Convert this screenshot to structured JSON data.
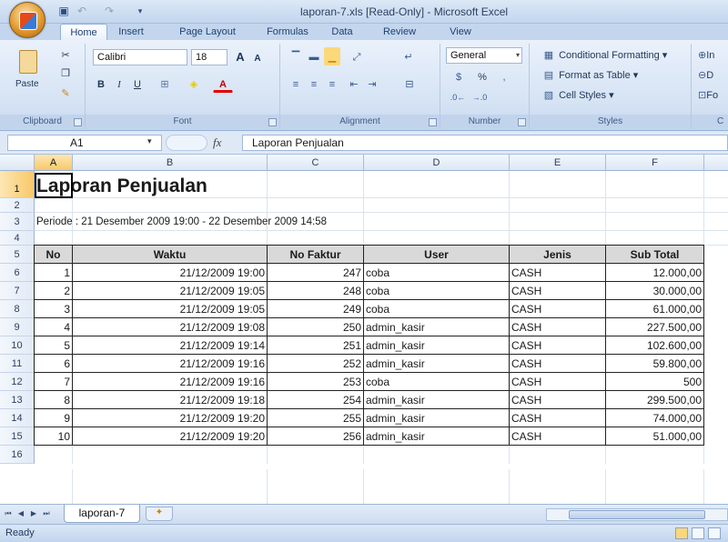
{
  "window": {
    "title": "laporan-7.xls  [Read-Only]  -  Microsoft Excel"
  },
  "ribbon": {
    "tabs": [
      "Home",
      "Insert",
      "Page Layout",
      "Formulas",
      "Data",
      "Review",
      "View"
    ],
    "clipboard": {
      "paste": "Paste",
      "label": "Clipboard"
    },
    "font": {
      "name": "Calibri",
      "size": "18",
      "grow": "A",
      "shrink": "A",
      "bold": "B",
      "italic": "I",
      "underline": "U",
      "label": "Font"
    },
    "alignment": {
      "label": "Alignment"
    },
    "number": {
      "format": "General",
      "percent": "%",
      "label": "Number"
    },
    "styles": {
      "conditional": "Conditional Formatting",
      "table": "Format as Table",
      "cell_styles": "Cell Styles",
      "label": "Styles"
    },
    "cells": {
      "insert": "In",
      "delete": "D",
      "format": "Fo",
      "label": "C"
    }
  },
  "formula_bar": {
    "name_box": "A1",
    "fx": "fx",
    "value": "Laporan Penjualan"
  },
  "columns": [
    "A",
    "B",
    "C",
    "D",
    "E",
    "F"
  ],
  "rows": [
    "1",
    "2",
    "3",
    "4",
    "5",
    "6",
    "7",
    "8",
    "9",
    "10",
    "11",
    "12",
    "13",
    "14",
    "15",
    "16"
  ],
  "sheet": {
    "title": "Laporan Penjualan",
    "period": "Periode : 21 Desember 2009 19:00 - 22 Desember 2009 14:58",
    "headers": [
      "No",
      "Waktu",
      "No Faktur",
      "User",
      "Jenis",
      "Sub Total"
    ],
    "table": [
      [
        "1",
        "21/12/2009 19:00",
        "247",
        "coba",
        "CASH",
        "12.000,00"
      ],
      [
        "2",
        "21/12/2009 19:05",
        "248",
        "coba",
        "CASH",
        "30.000,00"
      ],
      [
        "3",
        "21/12/2009 19:05",
        "249",
        "coba",
        "CASH",
        "61.000,00"
      ],
      [
        "4",
        "21/12/2009 19:08",
        "250",
        "admin_kasir",
        "CASH",
        "227.500,00"
      ],
      [
        "5",
        "21/12/2009 19:14",
        "251",
        "admin_kasir",
        "CASH",
        "102.600,00"
      ],
      [
        "6",
        "21/12/2009 19:16",
        "252",
        "admin_kasir",
        "CASH",
        "59.800,00"
      ],
      [
        "7",
        "21/12/2009 19:16",
        "253",
        "coba",
        "CASH",
        "500"
      ],
      [
        "8",
        "21/12/2009 19:18",
        "254",
        "admin_kasir",
        "CASH",
        "299.500,00"
      ],
      [
        "9",
        "21/12/2009 19:20",
        "255",
        "admin_kasir",
        "CASH",
        "74.000,00"
      ],
      [
        "10",
        "21/12/2009 19:20",
        "256",
        "admin_kasir",
        "CASH",
        "51.000,00"
      ]
    ]
  },
  "sheet_tabs": {
    "active": "laporan-7"
  },
  "status": {
    "text": "Ready"
  }
}
